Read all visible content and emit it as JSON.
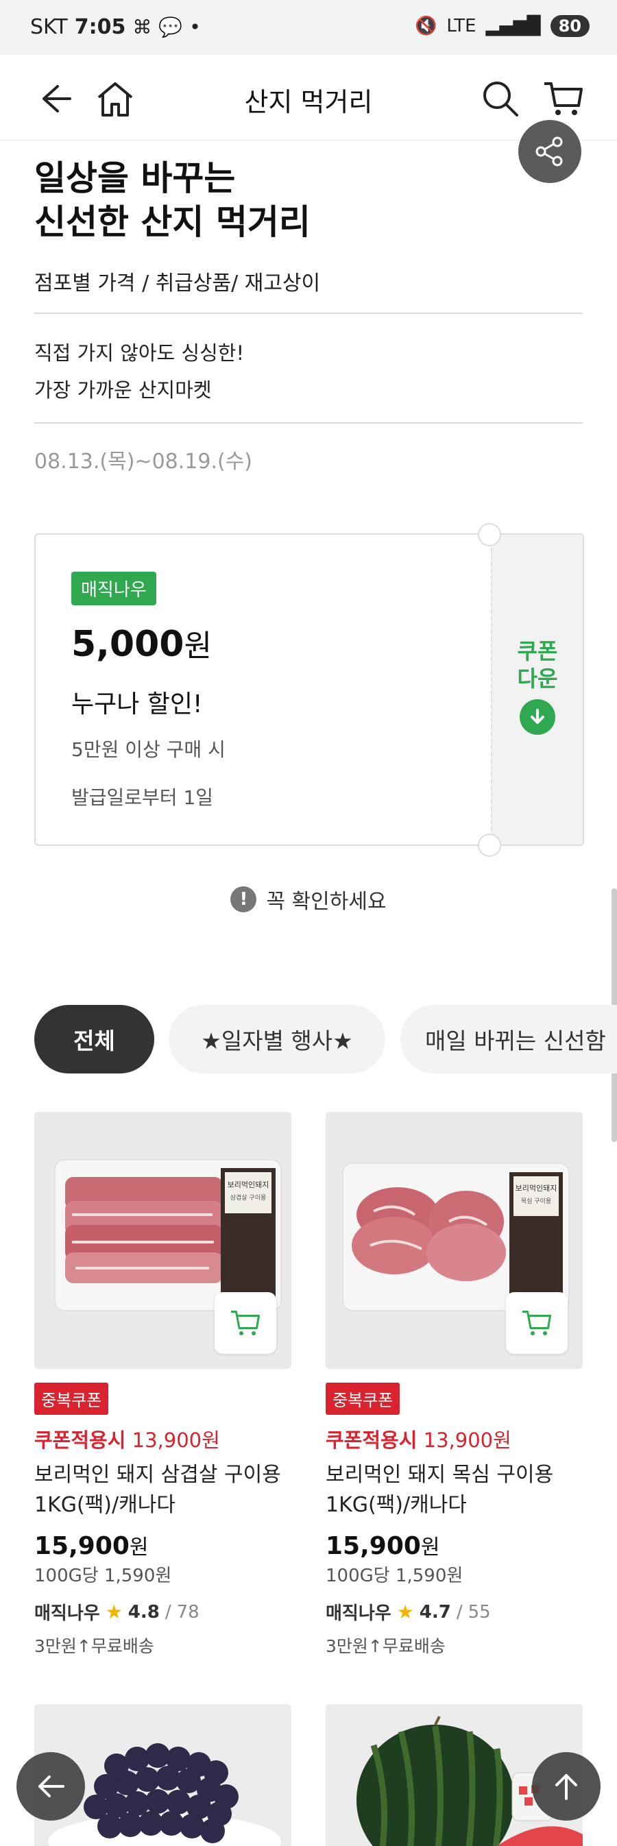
{
  "status_bar": {
    "carrier": "SKT",
    "time": "7:05",
    "network": "LTE",
    "battery": "80",
    "icons": [
      "dot-icon",
      "talk-icon",
      "screenshot-icon",
      "mute-icon",
      "signal-icon"
    ]
  },
  "header": {
    "title": "산지 먹거리",
    "icons": [
      "back-arrow-icon",
      "home-icon",
      "search-icon",
      "cart-icon"
    ]
  },
  "hero": {
    "headline_line1": "일상을 바꾸는",
    "headline_line2": "신선한 산지 먹거리",
    "sub_note": "점포별 가격 / 취급상품/ 재고상이",
    "desc_line1": "직접 가지 않아도 싱싱한!",
    "desc_line2": "가장 가까운 산지마켓",
    "period": "08.13.(목)~08.19.(수)"
  },
  "coupon": {
    "badge": "매직나우",
    "amount": "5,000",
    "amount_unit": "원",
    "title": "누구나 할인!",
    "condition": "5만원 이상 구매 시",
    "validity": "발급일로부터 1일",
    "download_line1": "쿠폰",
    "download_line2": "다운",
    "accent_color": "#2fa84f"
  },
  "notice": {
    "text": "꼭 확인하세요",
    "icon": "!"
  },
  "categories": [
    {
      "label": "전체",
      "active": true
    },
    {
      "label": "★일자별 행사★",
      "active": false
    },
    {
      "label": "매일 바뀌는 신선함",
      "active": false
    }
  ],
  "products": [
    {
      "badge": "중복쿠폰",
      "coupon_label": "쿠폰적용시",
      "coupon_price": "13,900원",
      "name": "보리먹인 돼지 삼겹살 구이용 1KG(팩)/캐나다",
      "price": "15,900",
      "price_unit": "원",
      "unit_price": "100G당 1,590원",
      "brand": "매직나우",
      "rating": "4.8",
      "reviews": "78",
      "shipping": "3만원↑무료배송",
      "package_label": "보리먹인돼지",
      "package_sub": "삼겹살 구이용"
    },
    {
      "badge": "중복쿠폰",
      "coupon_label": "쿠폰적용시",
      "coupon_price": "13,900원",
      "name": "보리먹인 돼지 목심 구이용 1KG(팩)/캐나다",
      "price": "15,900",
      "price_unit": "원",
      "unit_price": "100G당 1,590원",
      "brand": "매직나우",
      "rating": "4.7",
      "reviews": "55",
      "shipping": "3만원↑무료배송",
      "package_label": "보리먹인돼지",
      "package_sub": "목심 구이용"
    }
  ],
  "colors": {
    "accent_red": "#d9242f",
    "accent_green": "#2fa84f",
    "star": "#f5b400"
  },
  "fabs": [
    "back-fab-icon",
    "scroll-top-icon"
  ]
}
